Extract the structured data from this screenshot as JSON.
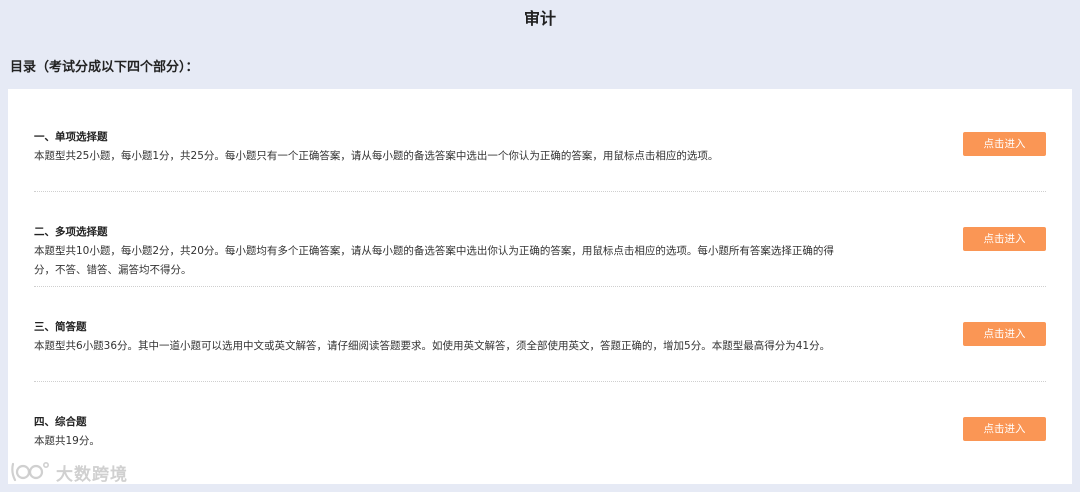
{
  "header": {
    "title": "审计"
  },
  "toc": {
    "heading": "目录（考试分成以下四个部分）："
  },
  "sections": [
    {
      "title": "一、单项选择题",
      "description": "本题型共25小题，每小题1分，共25分。每小题只有一个正确答案，请从每小题的备选答案中选出一个你认为正确的答案，用鼠标点击相应的选项。",
      "button_label": "点击进入"
    },
    {
      "title": "二、多项选择题",
      "description": "本题型共10小题，每小题2分，共20分。每小题均有多个正确答案，请从每小题的备选答案中选出你认为正确的答案，用鼠标点击相应的选项。每小题所有答案选择正确的得分，不答、错答、漏答均不得分。",
      "button_label": "点击进入"
    },
    {
      "title": "三、简答题",
      "description": "本题型共6小题36分。其中一道小题可以选用中文或英文解答，请仔细阅读答题要求。如使用英文解答，须全部使用英文，答题正确的，增加5分。本题型最高得分为41分。",
      "button_label": "点击进入"
    },
    {
      "title": "四、综合题",
      "description": "本题共19分。",
      "button_label": "点击进入"
    }
  ],
  "watermark": {
    "text": "大数跨境"
  },
  "colors": {
    "background": "#e6eaf5",
    "panel": "#ffffff",
    "button": "#fa9655",
    "button_text": "#ffffff"
  }
}
